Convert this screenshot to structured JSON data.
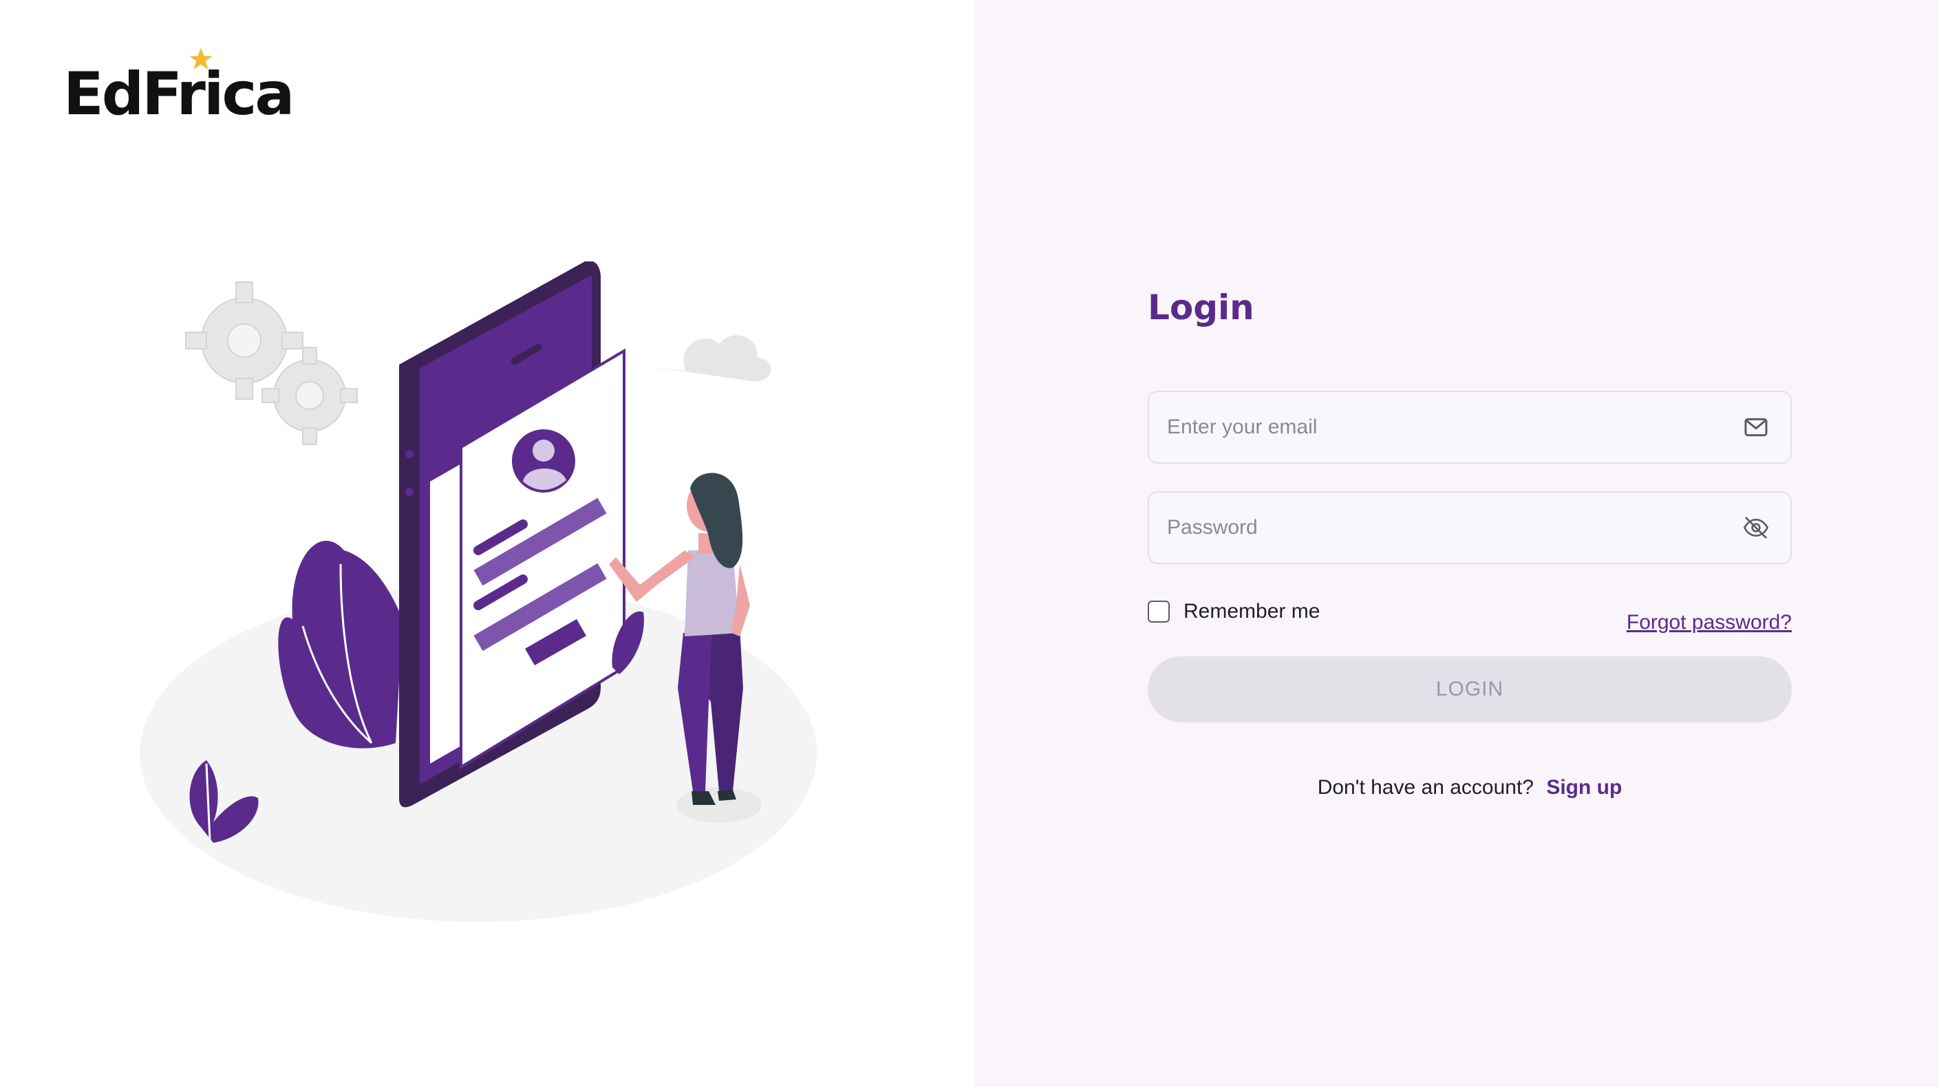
{
  "brand": {
    "name": "EdFrica",
    "star_color": "#f5b82e"
  },
  "login": {
    "title": "Login",
    "email": {
      "placeholder": "Enter your email",
      "value": "",
      "icon": "mail-icon"
    },
    "password": {
      "placeholder": "Password",
      "value": "",
      "icon": "eye-off-icon"
    },
    "remember_label": "Remember me",
    "remember_checked": false,
    "forgot_label": "Forgot password?",
    "submit_label": "LOGIN",
    "signup_prompt": "Don't have an account?",
    "signup_label": "Sign up"
  },
  "colors": {
    "accent": "#5a2b8c",
    "panel_bg": "#f9f5fb",
    "button_disabled_bg": "#e3e0e8",
    "button_disabled_text": "#9b98a3"
  }
}
